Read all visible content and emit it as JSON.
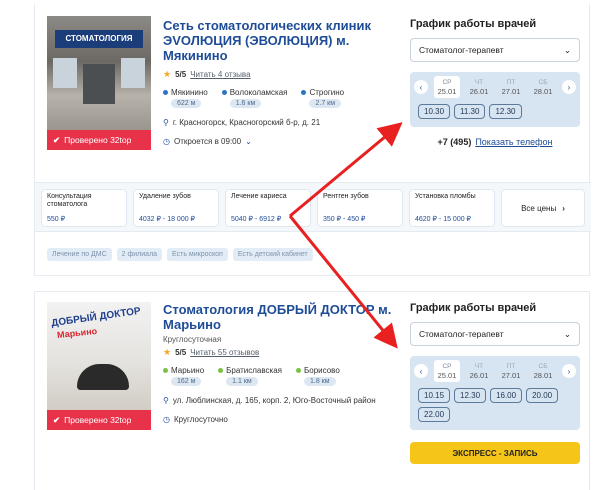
{
  "clinics": [
    {
      "title": "Сеть стоматологических клиник ЭVОЛЮЦИЯ (ЭВОЛЮЦИЯ) м. Мякинино",
      "subtitle": "",
      "photo_sign": "СТОМАТОЛОГИЯ",
      "verified": "Проверено 32top",
      "rating": "5/5",
      "reviews_link": "Читать 4 отзыва",
      "metro": [
        {
          "name": "Мякинино",
          "distance": "622 м",
          "color": "#2d73c5"
        },
        {
          "name": "Волоколамская",
          "distance": "1.6 км",
          "color": "#2d73c5"
        },
        {
          "name": "Строгино",
          "distance": "2.7 км",
          "color": "#2d73c5"
        }
      ],
      "address": "г. Красногорск, Красногорский б-р, д. 21",
      "hours": "Откроется в 09:00",
      "schedule": {
        "title": "График работы врачей",
        "doctor": "Стоматолог-терапевт",
        "days": [
          {
            "wd": "СР",
            "date": "25.01",
            "active": true
          },
          {
            "wd": "ЧТ",
            "date": "26.01",
            "active": false
          },
          {
            "wd": "ПТ",
            "date": "27.01",
            "active": false
          },
          {
            "wd": "СБ",
            "date": "28.01",
            "active": false
          }
        ],
        "times": [
          "10.30",
          "11.30",
          "12.30"
        ]
      },
      "phone": "+7 (495)",
      "phone_link": "Показать телефон",
      "services": [
        {
          "name": "Консультация стоматолога",
          "price": "550 ₽"
        },
        {
          "name": "Удаление зубов",
          "price": "4032 ₽ - 18 000 ₽"
        },
        {
          "name": "Лечение кариеса",
          "price": "5040 ₽ - 6912 ₽"
        },
        {
          "name": "Рентген зубов",
          "price": "350 ₽ - 450 ₽"
        },
        {
          "name": "Установка пломбы",
          "price": "4620 ₽ - 15 000 ₽"
        }
      ],
      "all_prices": "Все цены",
      "tags": [
        "Лечение по ДМС",
        "2 филиала",
        "Есть микроскоп",
        "Есть детский кабинет"
      ]
    },
    {
      "title": "Стоматология ДОБРЫЙ ДОКТОР м. Марьино",
      "subtitle": "Круглосуточная",
      "photo_sign_1": "ДОБРЫЙ ДОКТОР",
      "photo_sign_2": "Марьино",
      "verified": "Проверено 32top",
      "rating": "5/5",
      "reviews_link": "Читать 55 отзывов",
      "metro": [
        {
          "name": "Марьино",
          "distance": "162 м",
          "color": "#7ac143"
        },
        {
          "name": "Братиславская",
          "distance": "1.1 км",
          "color": "#7ac143"
        },
        {
          "name": "Борисово",
          "distance": "1.8 км",
          "color": "#7ac143"
        }
      ],
      "address": "ул. Люблинская, д. 165, корп. 2, Юго-Восточный район",
      "hours": "Круглосуточно",
      "schedule": {
        "title": "График работы врачей",
        "doctor": "Стоматолог-терапевт",
        "days": [
          {
            "wd": "СР",
            "date": "25.01",
            "active": true
          },
          {
            "wd": "ЧТ",
            "date": "26.01",
            "active": false
          },
          {
            "wd": "ПТ",
            "date": "27.01",
            "active": false
          },
          {
            "wd": "СБ",
            "date": "28.01",
            "active": false
          }
        ],
        "times": [
          "10.15",
          "12.30",
          "16.00",
          "20.00",
          "22.00"
        ]
      },
      "express": "ЭКСПРЕСС - ЗАПИСЬ"
    }
  ],
  "colors": {
    "accent": "#1e4c97",
    "verified": "#e8324a",
    "panel": "#d7e4f1",
    "express": "#f5c518",
    "arrow": "#e8201f"
  },
  "icons": {
    "star": "★",
    "pin": "⚲",
    "clock": "◷",
    "chevron_down": "⌄",
    "check": "✔",
    "prev": "‹",
    "next": "›",
    "select_chevron": "⌄"
  }
}
